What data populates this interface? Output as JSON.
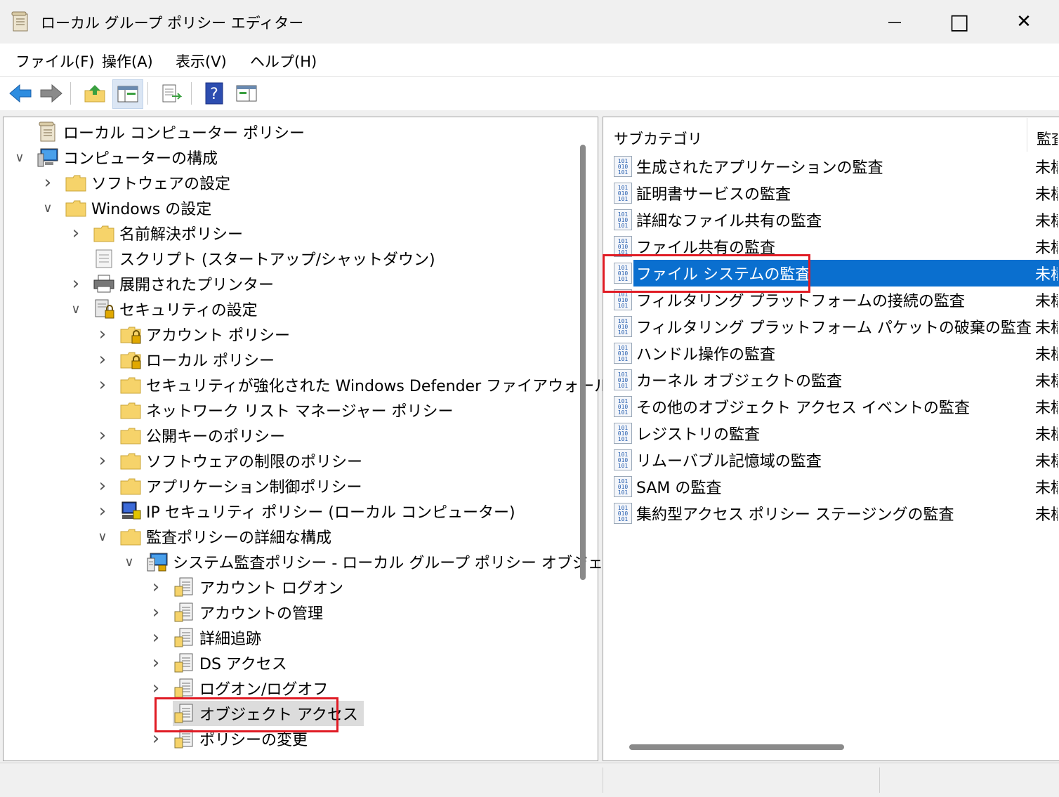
{
  "window": {
    "title": "ローカル グループ ポリシー エディター",
    "minimize_glyph": "—",
    "maximize_glyph": "□",
    "close_glyph": "✕"
  },
  "menu": [
    "ファイル(F)",
    "操作(A)",
    "表示(V)",
    "ヘルプ(H)"
  ],
  "toolbar_icons": [
    "back-arrow-icon",
    "forward-arrow-icon",
    "up-folder-icon",
    "show-hide-tree-icon",
    "export-list-icon",
    "help-icon",
    "show-action-pane-icon"
  ],
  "tree": [
    {
      "label": "ローカル コンピューター ポリシー",
      "icon": "policy-doc-icon",
      "chevron": ""
    },
    {
      "label": "コンピューターの構成",
      "icon": "computer-icon",
      "chevron": "∨"
    },
    {
      "label": "ソフトウェアの設定",
      "icon": "folder-icon",
      "chevron": "›"
    },
    {
      "label": "Windows の設定",
      "icon": "folder-icon",
      "chevron": "∨"
    },
    {
      "label": "名前解決ポリシー",
      "icon": "folder-icon",
      "chevron": "›"
    },
    {
      "label": "スクリプト (スタートアップ/シャットダウン)",
      "icon": "script-icon",
      "chevron": ""
    },
    {
      "label": "展開されたプリンター",
      "icon": "printer-icon",
      "chevron": "›"
    },
    {
      "label": "セキュリティの設定",
      "icon": "security-settings-icon",
      "chevron": "∨"
    },
    {
      "label": "アカウント ポリシー",
      "icon": "locked-folder-icon",
      "chevron": "›"
    },
    {
      "label": "ローカル ポリシー",
      "icon": "locked-folder-icon",
      "chevron": "›"
    },
    {
      "label": "セキュリティが強化された Windows Defender ファイアウォール",
      "icon": "folder-icon",
      "chevron": "›"
    },
    {
      "label": "ネットワーク リスト マネージャー ポリシー",
      "icon": "folder-icon",
      "chevron": ""
    },
    {
      "label": "公開キーのポリシー",
      "icon": "folder-icon",
      "chevron": "›"
    },
    {
      "label": "ソフトウェアの制限のポリシー",
      "icon": "folder-icon",
      "chevron": "›"
    },
    {
      "label": "アプリケーション制御ポリシー",
      "icon": "folder-icon",
      "chevron": "›"
    },
    {
      "label": "IP セキュリティ ポリシー (ローカル コンピューター)",
      "icon": "ip-security-icon",
      "chevron": "›"
    },
    {
      "label": "監査ポリシーの詳細な構成",
      "icon": "folder-icon",
      "chevron": "∨"
    },
    {
      "label": "システム監査ポリシー - ローカル グループ ポリシー オブジェクト",
      "icon": "audit-policy-icon",
      "chevron": "∨"
    },
    {
      "label": "アカウント ログオン",
      "icon": "audit-category-icon",
      "chevron": "›"
    },
    {
      "label": "アカウントの管理",
      "icon": "audit-category-icon",
      "chevron": "›"
    },
    {
      "label": "詳細追跡",
      "icon": "audit-category-icon",
      "chevron": "›"
    },
    {
      "label": "DS アクセス",
      "icon": "audit-category-icon",
      "chevron": "›"
    },
    {
      "label": "ログオン/ログオフ",
      "icon": "audit-category-icon",
      "chevron": "›"
    },
    {
      "label": "オブジェクト アクセス",
      "icon": "audit-category-icon",
      "chevron": "",
      "selected": true
    },
    {
      "label": "ポリシーの変更",
      "icon": "audit-category-icon",
      "chevron": "›"
    }
  ],
  "list": {
    "columns": [
      "サブカテゴリ",
      "監査"
    ],
    "rows": [
      {
        "name": "生成されたアプリケーションの監査",
        "status": "未構"
      },
      {
        "name": "証明書サービスの監査",
        "status": "未構"
      },
      {
        "name": "詳細なファイル共有の監査",
        "status": "未構"
      },
      {
        "name": "ファイル共有の監査",
        "status": "未構"
      },
      {
        "name": "ファイル システムの監査",
        "status": "未構",
        "selected": true
      },
      {
        "name": "フィルタリング プラットフォームの接続の監査",
        "status": "未構"
      },
      {
        "name": "フィルタリング プラットフォーム パケットの破棄の監査",
        "status": "未構"
      },
      {
        "name": "ハンドル操作の監査",
        "status": "未構"
      },
      {
        "name": "カーネル オブジェクトの監査",
        "status": "未構"
      },
      {
        "name": "その他のオブジェクト アクセス イベントの監査",
        "status": "未構"
      },
      {
        "name": "レジストリの監査",
        "status": "未構"
      },
      {
        "name": "リムーバブル記憶域の監査",
        "status": "未構"
      },
      {
        "name": "SAM の監査",
        "status": "未構"
      },
      {
        "name": "集約型アクセス ポリシー ステージングの監査",
        "status": "未構"
      }
    ]
  },
  "colors": {
    "selection": "#0a6fcf",
    "highlight_box": "#e01b24",
    "tree_selection": "#dcdcdc"
  }
}
